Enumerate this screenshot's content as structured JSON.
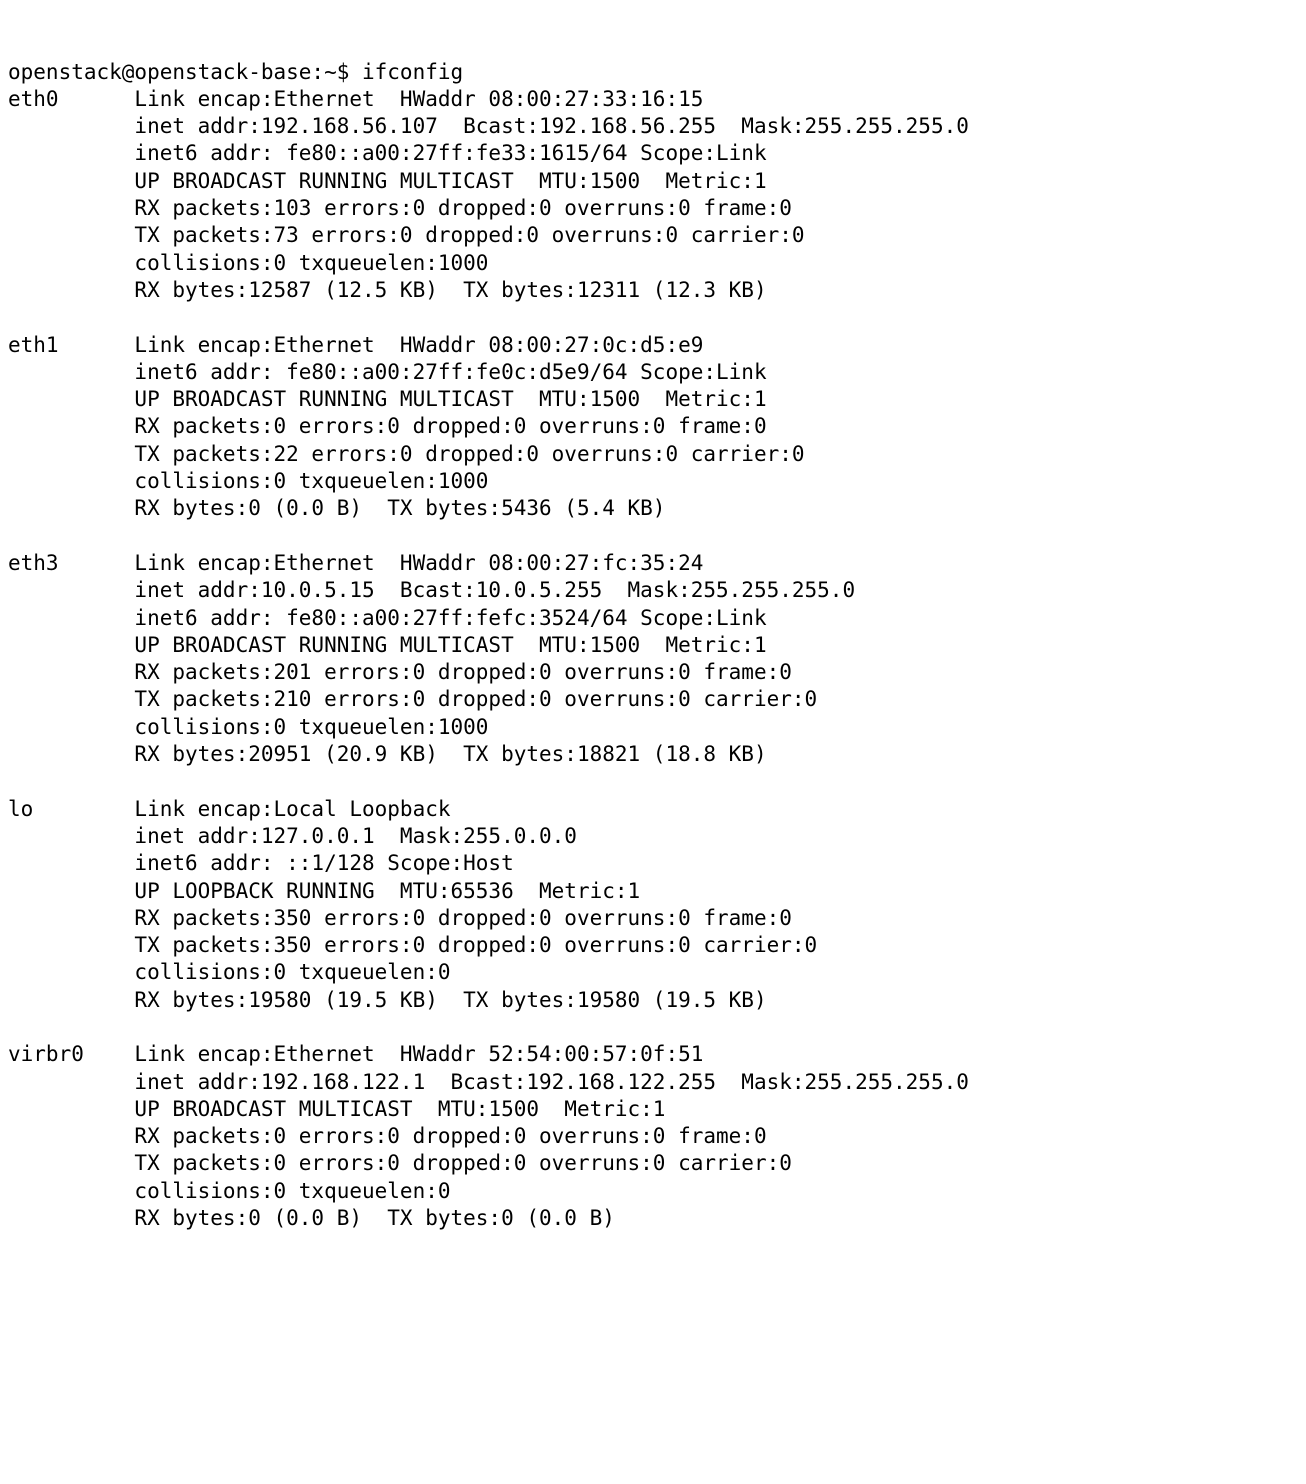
{
  "prompt": {
    "user_host": "openstack@openstack-base",
    "cwd": "~",
    "separator": ":",
    "symbol": "$",
    "command": "ifconfig"
  },
  "interfaces": [
    {
      "name": "eth0",
      "lines": [
        "Link encap:Ethernet  HWaddr 08:00:27:33:16:15",
        "inet addr:192.168.56.107  Bcast:192.168.56.255  Mask:255.255.255.0",
        "inet6 addr: fe80::a00:27ff:fe33:1615/64 Scope:Link",
        "UP BROADCAST RUNNING MULTICAST  MTU:1500  Metric:1",
        "RX packets:103 errors:0 dropped:0 overruns:0 frame:0",
        "TX packets:73 errors:0 dropped:0 overruns:0 carrier:0",
        "collisions:0 txqueuelen:1000",
        "RX bytes:12587 (12.5 KB)  TX bytes:12311 (12.3 KB)"
      ]
    },
    {
      "name": "eth1",
      "lines": [
        "Link encap:Ethernet  HWaddr 08:00:27:0c:d5:e9",
        "inet6 addr: fe80::a00:27ff:fe0c:d5e9/64 Scope:Link",
        "UP BROADCAST RUNNING MULTICAST  MTU:1500  Metric:1",
        "RX packets:0 errors:0 dropped:0 overruns:0 frame:0",
        "TX packets:22 errors:0 dropped:0 overruns:0 carrier:0",
        "collisions:0 txqueuelen:1000",
        "RX bytes:0 (0.0 B)  TX bytes:5436 (5.4 KB)"
      ]
    },
    {
      "name": "eth3",
      "lines": [
        "Link encap:Ethernet  HWaddr 08:00:27:fc:35:24",
        "inet addr:10.0.5.15  Bcast:10.0.5.255  Mask:255.255.255.0",
        "inet6 addr: fe80::a00:27ff:fefc:3524/64 Scope:Link",
        "UP BROADCAST RUNNING MULTICAST  MTU:1500  Metric:1",
        "RX packets:201 errors:0 dropped:0 overruns:0 frame:0",
        "TX packets:210 errors:0 dropped:0 overruns:0 carrier:0",
        "collisions:0 txqueuelen:1000",
        "RX bytes:20951 (20.9 KB)  TX bytes:18821 (18.8 KB)"
      ]
    },
    {
      "name": "lo",
      "lines": [
        "Link encap:Local Loopback",
        "inet addr:127.0.0.1  Mask:255.0.0.0",
        "inet6 addr: ::1/128 Scope:Host",
        "UP LOOPBACK RUNNING  MTU:65536  Metric:1",
        "RX packets:350 errors:0 dropped:0 overruns:0 frame:0",
        "TX packets:350 errors:0 dropped:0 overruns:0 carrier:0",
        "collisions:0 txqueuelen:0",
        "RX bytes:19580 (19.5 KB)  TX bytes:19580 (19.5 KB)"
      ]
    },
    {
      "name": "virbr0",
      "lines": [
        "Link encap:Ethernet  HWaddr 52:54:00:57:0f:51",
        "inet addr:192.168.122.1  Bcast:192.168.122.255  Mask:255.255.255.0",
        "UP BROADCAST MULTICAST  MTU:1500  Metric:1",
        "RX packets:0 errors:0 dropped:0 overruns:0 frame:0",
        "TX packets:0 errors:0 dropped:0 overruns:0 carrier:0",
        "collisions:0 txqueuelen:0",
        "RX bytes:0 (0.0 B)  TX bytes:0 (0.0 B)"
      ]
    }
  ]
}
